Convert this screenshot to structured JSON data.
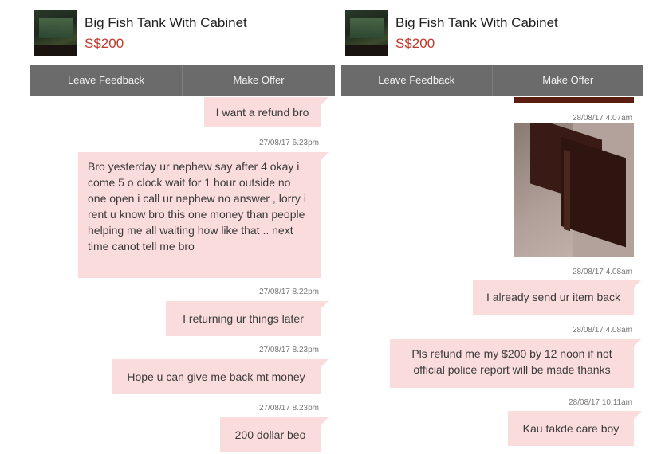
{
  "left": {
    "header": {
      "title": "Big Fish Tank With Cabinet",
      "price": "S$200"
    },
    "actions": {
      "leave_feedback": "Leave Feedback",
      "make_offer": "Make Offer"
    },
    "messages": [
      {
        "text": "I want a refund bro"
      },
      {
        "timestamp": "27/08/17 6.23pm",
        "text": "Bro yesterday ur nephew  say after 4 okay i  come 5 o clock wait for 1 hour outside no one open i call ur nephew no answer , lorry i rent u know bro this one money than people helping me all waiting how like that .. next time canot tell me bro"
      },
      {
        "timestamp": "27/08/17 8.22pm",
        "text": "I returning ur things later"
      },
      {
        "timestamp": "27/08/17 8.23pm",
        "text": "Hope u can give me back mt money"
      },
      {
        "timestamp": "27/08/17 8.23pm",
        "text": "200 dollar beo"
      }
    ]
  },
  "right": {
    "header": {
      "title": "Big Fish Tank With Cabinet",
      "price": "S$200"
    },
    "actions": {
      "leave_feedback": "Leave Feedback",
      "make_offer": "Make Offer"
    },
    "messages": [
      {
        "timestamp": "28/08/17 4.07am"
      },
      {
        "timestamp": "28/08/17 4.08am",
        "text": "I already send ur item back"
      },
      {
        "timestamp": "28/08/17 4.08am",
        "text": "Pls refund me my $200 by 12 noon if not official police report will be made  thanks"
      },
      {
        "timestamp": "28/08/17 10.11am",
        "text": "Kau takde care boy"
      }
    ]
  }
}
